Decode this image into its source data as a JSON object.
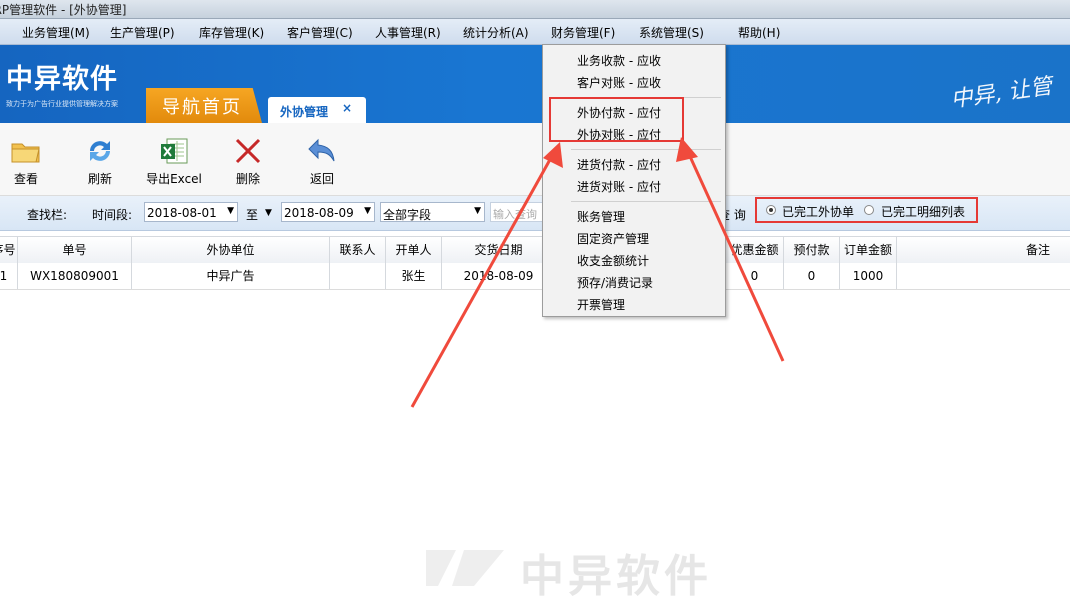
{
  "window": {
    "title": "ERP管理软件 - [外协管理]"
  },
  "menubar": {
    "items": [
      {
        "label": "业务管理(M)"
      },
      {
        "label": "生产管理(P)"
      },
      {
        "label": "库存管理(K)"
      },
      {
        "label": "客户管理(C)"
      },
      {
        "label": "人事管理(R)"
      },
      {
        "label": "统计分析(A)"
      },
      {
        "label": "财务管理(F)"
      },
      {
        "label": "系统管理(S)"
      },
      {
        "label": "帮助(H)"
      }
    ]
  },
  "banner": {
    "logo": "中异软件",
    "tagline": "致力于为广告行业提供管理解决方案",
    "slogan": "中异, 让管",
    "home_tab": "导航首页",
    "active_tab": "外协管理",
    "active_tab_close": "×"
  },
  "toolbar": {
    "items": [
      {
        "label": "查看",
        "icon": "folder-icon"
      },
      {
        "label": "刷新",
        "icon": "refresh-icon"
      },
      {
        "label": "导出Excel",
        "icon": "excel-icon"
      },
      {
        "label": "删除",
        "icon": "delete-icon"
      },
      {
        "label": "返回",
        "icon": "back-icon"
      }
    ]
  },
  "search": {
    "label": "查找栏:",
    "period_label": "时间段:",
    "date_from": "2018-08-01",
    "to_label": "至",
    "date_to": "2018-08-09",
    "field_select": "全部字段",
    "input_placeholder": "输入查询",
    "query_label": "查 询",
    "radio_completed_orders": "已完工外协单",
    "radio_completed_details": "已完工明细列表"
  },
  "grid": {
    "columns": [
      "序号",
      "单号",
      "外协单位",
      "联系人",
      "开单人",
      "交货日期",
      "优惠金额",
      "预付款",
      "订单金额",
      "备注"
    ],
    "rows": [
      {
        "index": "1",
        "order_no": "WX180809001",
        "vendor": "中异广告",
        "contact": "",
        "creator": "张生",
        "delivery": "2018-08-09",
        "discount": "0",
        "prepay": "0",
        "amount": "1000",
        "note": ""
      }
    ]
  },
  "finance_menu": {
    "items": [
      "业务收款 - 应收",
      "客户对账 - 应收",
      "外协付款 - 应付",
      "外协对账 - 应付",
      "进货付款 - 应付",
      "进货对账 - 应付",
      "账务管理",
      "固定资产管理",
      "收支金额统计",
      "预存/消费记录",
      "开票管理"
    ]
  },
  "watermark": "中异软件",
  "colors": {
    "banner": "#1976d2",
    "home_tab": "#f39c12",
    "highlight": "#e53935"
  }
}
